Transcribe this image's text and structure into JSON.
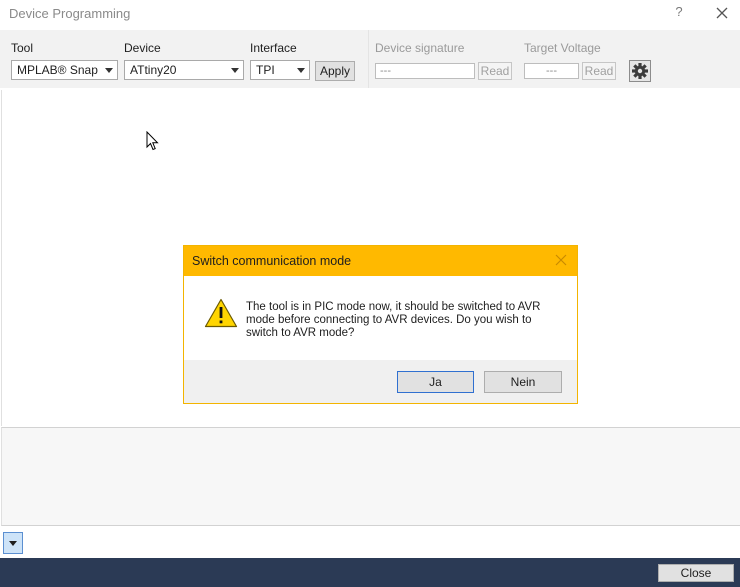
{
  "window": {
    "title": "Device Programming",
    "help_glyph": "?"
  },
  "toolbar": {
    "tool_label": "Tool",
    "tool_value": "MPLAB® Snap",
    "device_label": "Device",
    "device_value": "ATtiny20",
    "interface_label": "Interface",
    "interface_value": "TPI",
    "apply_label": "Apply",
    "signature_label": "Device signature",
    "signature_value": "---",
    "signature_read_label": "Read",
    "voltage_label": "Target Voltage",
    "voltage_value": "---",
    "voltage_read_label": "Read"
  },
  "dialog": {
    "title": "Switch communication mode",
    "message": "The tool is in PIC mode now, it should be switched to AVR\nmode before connecting to AVR devices. Do you wish to\nswitch to AVR mode?",
    "yes_label": "Ja",
    "no_label": "Nein",
    "header_color": "#ffb900"
  },
  "footer": {
    "close_label": "Close",
    "color": "#2b3a55"
  },
  "icons": [
    "close-icon",
    "help-icon",
    "gear-icon",
    "warning-icon",
    "mouse-cursor-icon",
    "dropdown-arrow-icon"
  ]
}
